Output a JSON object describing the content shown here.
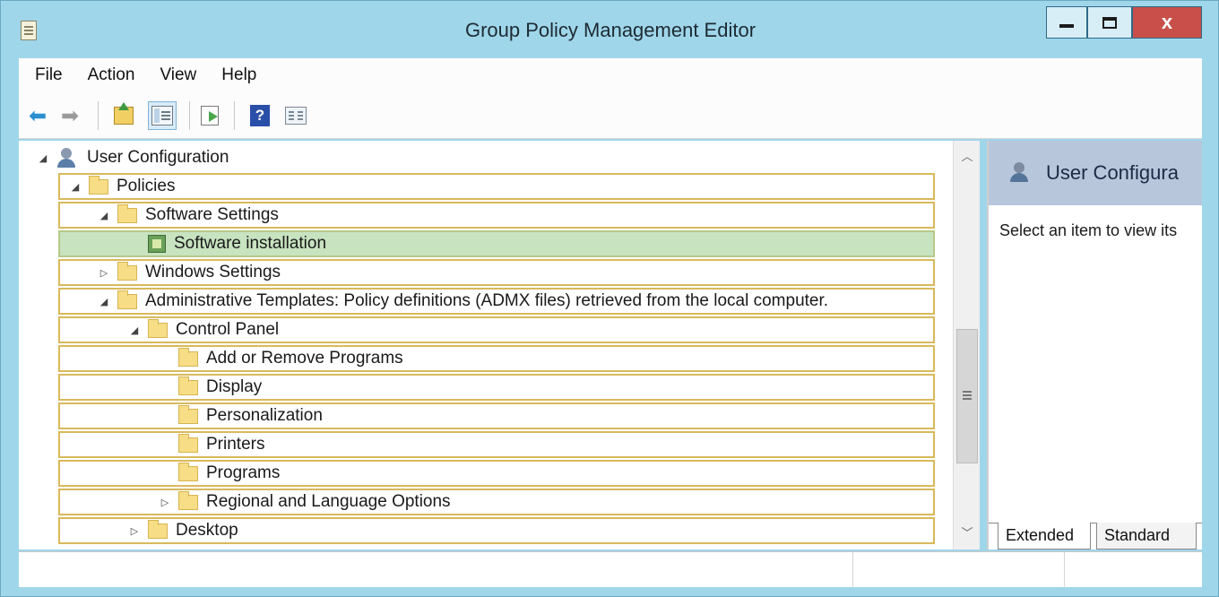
{
  "window": {
    "title": "Group Policy Management Editor",
    "close_label": "x"
  },
  "menu": [
    "File",
    "Action",
    "View",
    "Help"
  ],
  "toolbar": {
    "icons": [
      "back-arrow-icon",
      "forward-arrow-icon",
      "up-one-level-icon",
      "show-hide-console-tree-icon",
      "export-list-icon",
      "help-icon",
      "properties-icon"
    ]
  },
  "tree": {
    "rows": [
      {
        "label": "User Configuration",
        "expander": "◢"
      },
      {
        "label": "Policies",
        "expander": "◢"
      },
      {
        "label": "Software Settings",
        "expander": "◢"
      },
      {
        "label": "Software installation",
        "expander": ""
      },
      {
        "label": "Windows Settings",
        "expander": "▷"
      },
      {
        "label": "Administrative Templates: Policy definitions (ADMX files) retrieved from the local computer.",
        "expander": "◢"
      },
      {
        "label": "Control Panel",
        "expander": "◢"
      },
      {
        "label": "Add or Remove Programs",
        "expander": ""
      },
      {
        "label": "Display",
        "expander": ""
      },
      {
        "label": "Personalization",
        "expander": ""
      },
      {
        "label": "Printers",
        "expander": ""
      },
      {
        "label": "Programs",
        "expander": ""
      },
      {
        "label": "Regional and Language Options",
        "expander": "▷"
      },
      {
        "label": "Desktop",
        "expander": "▷"
      }
    ]
  },
  "side_pane": {
    "title": "User Configura",
    "description": "Select an item to view its",
    "tabs": [
      "Extended",
      "Standard"
    ]
  },
  "colors": {
    "selected_row": "#c7e3c0",
    "row_border": "#d8b95c",
    "window_frame": "#9fd6ea",
    "close_button": "#c9504a"
  }
}
